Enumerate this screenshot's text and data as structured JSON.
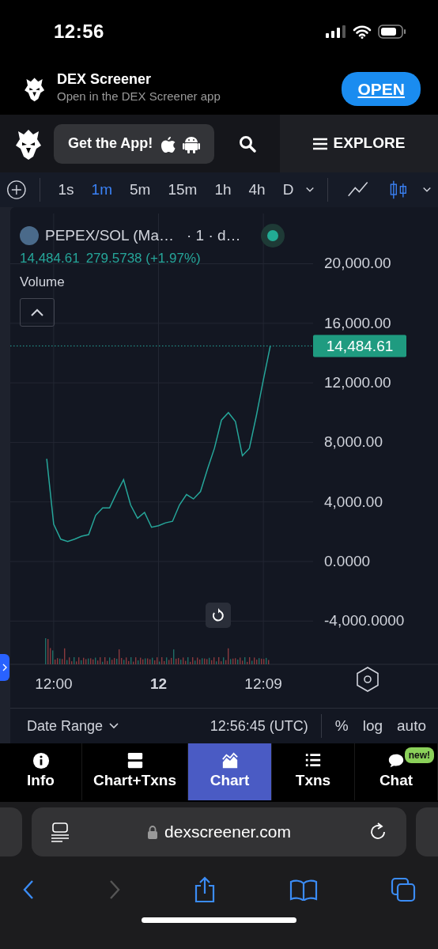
{
  "status_bar": {
    "time": "12:56"
  },
  "app_banner": {
    "title": "DEX Screener",
    "subtitle": "Open in the DEX Screener app",
    "button": "OPEN"
  },
  "header": {
    "get_app_button": "Get the App!",
    "explore_button": "EXPLORE"
  },
  "toolbar": {
    "intervals": [
      {
        "label": "1s",
        "selected": false
      },
      {
        "label": "1m",
        "selected": true
      },
      {
        "label": "5m",
        "selected": false
      },
      {
        "label": "15m",
        "selected": false
      },
      {
        "label": "1h",
        "selected": false
      },
      {
        "label": "4h",
        "selected": false
      },
      {
        "label": "D",
        "selected": false
      }
    ],
    "chart_types": [
      {
        "kind": "line",
        "selected": false
      },
      {
        "kind": "candles",
        "selected": true
      }
    ]
  },
  "chart": {
    "legend": {
      "title": "PEPEX/SOL (Ma…",
      "suffix": "· 1 · d…",
      "price": "14,484.61",
      "change": "279.5738 (+1.97%)",
      "indicator": "Volume"
    },
    "price_tag": "14,484.61",
    "chart_data": {
      "type": "line",
      "grid": true,
      "ylim": [
        -6906,
        23373
      ],
      "categories": [
        null,
        "12:00",
        null,
        null,
        null,
        null,
        null,
        null,
        null,
        null,
        null,
        null,
        null,
        null,
        null,
        null,
        "12",
        null,
        null,
        null,
        null,
        null,
        null,
        null,
        null,
        null,
        null,
        null,
        null,
        null,
        null,
        "12:09",
        null
      ],
      "yticks": [
        {
          "value": 20000,
          "label": "20,000.00"
        },
        {
          "value": 16000,
          "label": "16,000.00"
        },
        {
          "value": 12000,
          "label": "12,000.00"
        },
        {
          "value": 8000,
          "label": "8,000.00"
        },
        {
          "value": 4000,
          "label": "4,000.00"
        },
        {
          "value": 0,
          "label": "0.0000"
        },
        {
          "value": -4000,
          "label": "-4,000.0000"
        }
      ],
      "series": [
        {
          "color": "#26a69a",
          "values": [
            6900,
            2500,
            1500,
            1350,
            1500,
            1700,
            1800,
            3100,
            3600,
            3600,
            4600,
            5500,
            3800,
            2900,
            3300,
            2300,
            2400,
            2600,
            2700,
            3800,
            4500,
            4200,
            4700,
            6200,
            7600,
            9500,
            10000,
            9400,
            7100,
            7600,
            9800,
            12200,
            14480
          ]
        }
      ]
    }
  },
  "bottom_bar": {
    "date_range": "Date Range",
    "clock": "12:56:45 (UTC)",
    "options": [
      "%",
      "log",
      "auto"
    ]
  },
  "tabs": [
    {
      "label": "Info",
      "selected": false
    },
    {
      "label": "Chart+Txns",
      "selected": false
    },
    {
      "label": "Chart",
      "selected": true
    },
    {
      "label": "Txns",
      "selected": false
    },
    {
      "label": "Chat",
      "selected": false,
      "badge": "new!"
    }
  ],
  "browser": {
    "url": "dexscreener.com"
  }
}
